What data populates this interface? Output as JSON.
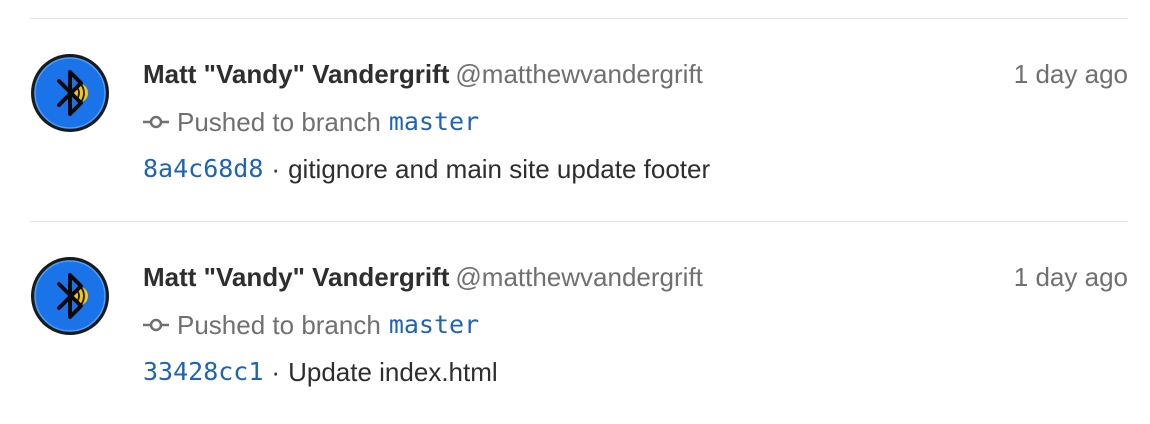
{
  "events": [
    {
      "author_name": "Matt \"Vandy\" Vandergrift",
      "author_username": "@matthewvandergrift",
      "timestamp": "1 day ago",
      "action_text": "Pushed to branch",
      "branch": "master",
      "commit_sha": "8a4c68d8",
      "separator": "·",
      "commit_message": "gitignore and main site update footer",
      "avatar_icon": "bluetooth-speaker-avatar"
    },
    {
      "author_name": "Matt \"Vandy\" Vandergrift",
      "author_username": "@matthewvandergrift",
      "timestamp": "1 day ago",
      "action_text": "Pushed to branch",
      "branch": "master",
      "commit_sha": "33428cc1",
      "separator": "·",
      "commit_message": "Update index.html",
      "avatar_icon": "bluetooth-speaker-avatar"
    }
  ],
  "colors": {
    "link": "#1f64b4",
    "muted": "#707070",
    "text": "#2e2e2e",
    "divider": "#e5e5e5",
    "avatar_blue": "#1a73e8",
    "avatar_yellow": "#f5c518"
  }
}
